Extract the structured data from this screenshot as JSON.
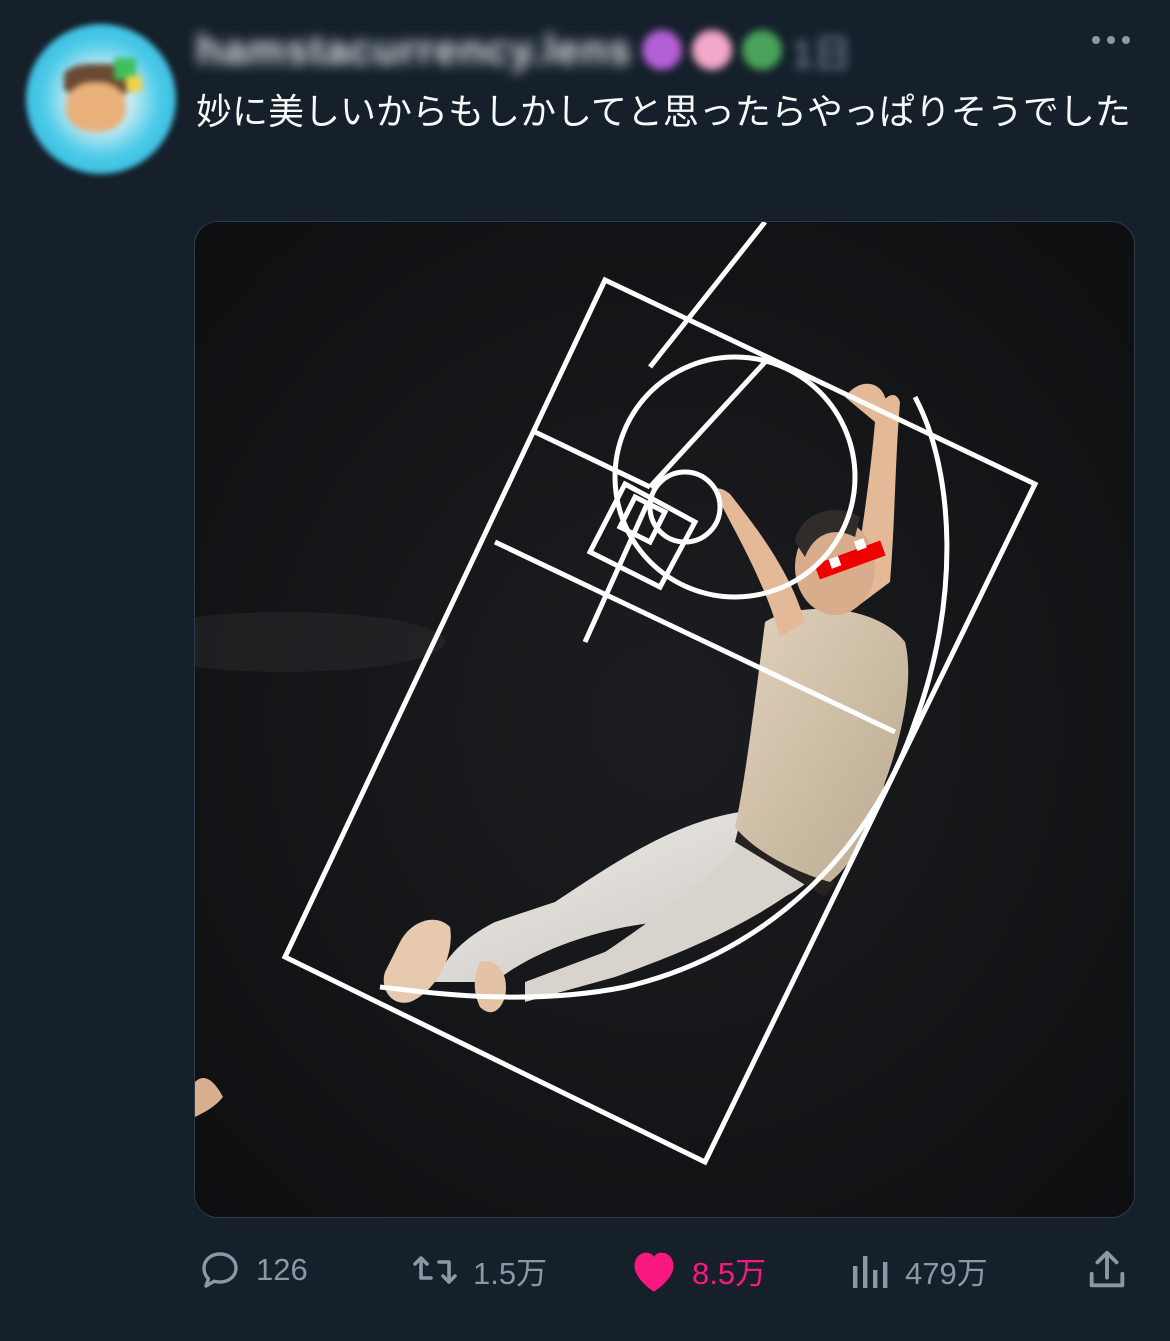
{
  "tweet": {
    "author": {
      "display_name": "hamstacurrency.lens",
      "handle": "1日"
    },
    "text": "妙に美しいからもしかしてと思ったらやっぱりそうでした",
    "media": {
      "icons": [
        "fibonacci-spiral-overlay",
        "red-pixel-sunglasses"
      ]
    },
    "actions": {
      "reply_count": "126",
      "repost_count": "1.5万",
      "like_count": "8.5万",
      "view_count": "479万",
      "liked": true
    },
    "colors": {
      "background": "#15202b",
      "text": "#f7f9f9",
      "muted": "#8b98a5",
      "like": "#f91880"
    }
  }
}
